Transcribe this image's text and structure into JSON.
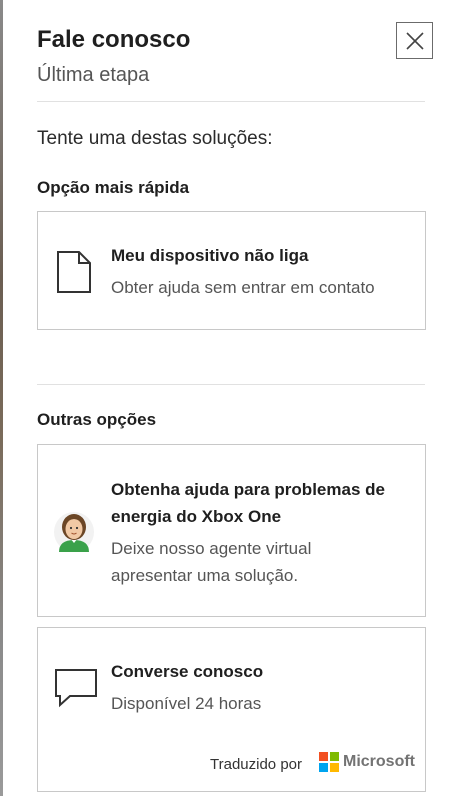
{
  "header": {
    "title": "Fale conosco",
    "subtitle": "Última etapa",
    "close_icon": "close-icon"
  },
  "prompt": "Tente uma destas soluções:",
  "fastest": {
    "heading": "Opção mais rápida",
    "card": {
      "icon": "document-icon",
      "title": "Meu dispositivo não liga",
      "subtitle": "Obter ajuda sem entrar em contato"
    }
  },
  "other": {
    "heading": "Outras opções",
    "agent_card": {
      "icon": "virtual-agent-avatar",
      "title_line1": "Obtenha ajuda para problemas de",
      "title_line2": "energia do Xbox One",
      "subtitle_line1": "Deixe nosso agente virtual",
      "subtitle_line2": "apresentar uma solução."
    },
    "chat_card": {
      "icon": "chat-bubble-icon",
      "title": "Converse conosco",
      "subtitle": "Disponível 24 horas",
      "translated_by": "Traduzido por",
      "brand": "Microsoft",
      "brand_colors": [
        "#f25022",
        "#7fba00",
        "#00a4ef",
        "#ffb900"
      ]
    }
  }
}
